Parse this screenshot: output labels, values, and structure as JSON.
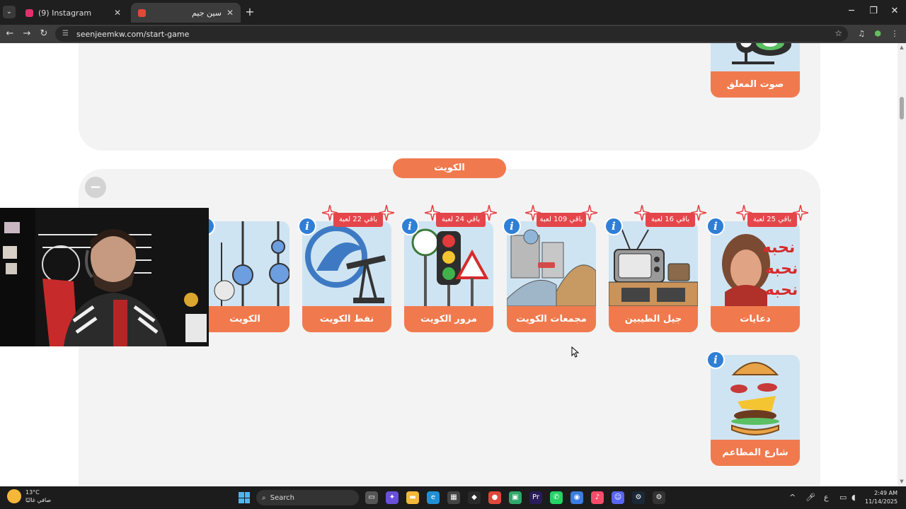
{
  "browser": {
    "tabs": [
      {
        "title": "(9) Instagram",
        "favicon_color": "#e1306c"
      },
      {
        "title": "سين جيم",
        "favicon_color": "#e04a3a"
      }
    ],
    "url": "seenjeemkw.com/start-game"
  },
  "page": {
    "top_card": {
      "label": "صوت المعلق"
    },
    "section_title": "الكويت",
    "collapse_symbol": "−",
    "cards": [
      {
        "label": "دعايات",
        "remaining": "باقي 25 لعبة"
      },
      {
        "label": "جيل الطيبين",
        "remaining": "باقي 16 لعبة"
      },
      {
        "label": "مجمعات الكويت",
        "remaining": "باقي 109 لعبة"
      },
      {
        "label": "مرور الكويت",
        "remaining": "باقي 24 لعبة"
      },
      {
        "label": "نفط الكويت",
        "remaining": "باقي 22 لعبة"
      },
      {
        "label": "الكويت",
        "remaining": ""
      }
    ],
    "bottom_card": {
      "label": "شارع المطاعم"
    },
    "ad_text": "نحبه",
    "info_glyph": "i"
  },
  "taskbar": {
    "weather_temp": "13°C",
    "weather_desc": "صافي غالبًا",
    "search_label": "Search",
    "lang": "ع",
    "time": "2:49 AM",
    "date": "11/14/2025"
  },
  "colors": {
    "accent": "#f07a4e",
    "ribbon": "#e4464a",
    "info": "#2f7fd6",
    "panel": "#f3f3f3"
  }
}
